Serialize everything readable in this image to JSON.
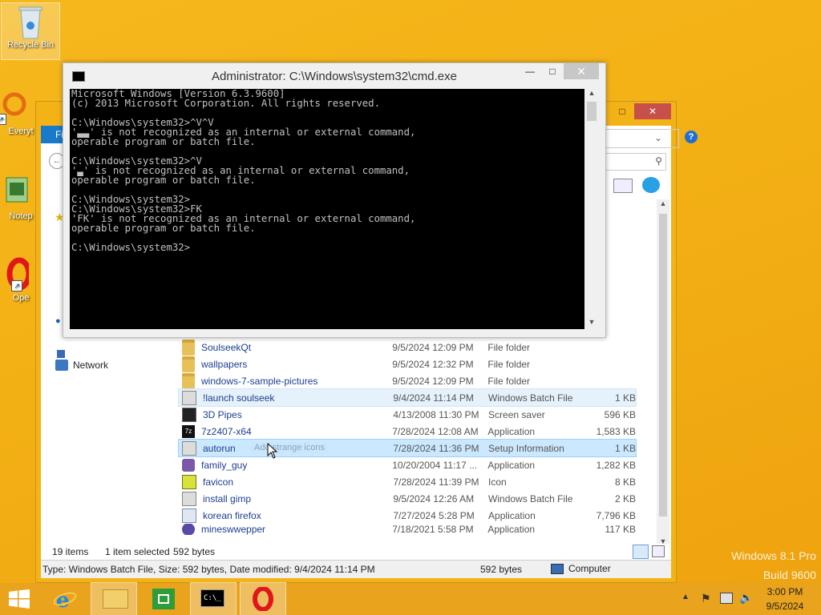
{
  "desktop": {
    "icons": [
      {
        "label": "Recycle Bin"
      },
      {
        "label": "Everyt"
      },
      {
        "label": "Notep"
      },
      {
        "label": "Ope"
      }
    ],
    "watermark_line1": "Windows 8.1 Pro",
    "watermark_line2": "Build 9600"
  },
  "cmd": {
    "title": "Administrator: C:\\Windows\\system32\\cmd.exe",
    "lines": [
      "Microsoft Windows [Version 6.3.9600]",
      "(c) 2013 Microsoft Corporation. All rights reserved.",
      "",
      "C:\\Windows\\system32>^V^V",
      "'▃▃' is not recognized as an internal or external command,",
      "operable program or batch file.",
      "",
      "C:\\Windows\\system32>^V",
      "'▃' is not recognized as an internal or external command,",
      "operable program or batch file.",
      "",
      "C:\\Windows\\system32>",
      "C:\\Windows\\system32>FK",
      "'FK' is not recognized as an internal or external command,",
      "operable program or batch file.",
      "",
      "C:\\Windows\\system32>"
    ]
  },
  "explorer": {
    "nav": {
      "network": "Network",
      "file_tab": "Fi"
    },
    "files": [
      {
        "name": "SoulseekQt",
        "date": "9/5/2024 12:09 PM",
        "type": "File folder",
        "size": "",
        "icon": "folder-icon"
      },
      {
        "name": "wallpapers",
        "date": "9/5/2024 12:32 PM",
        "type": "File folder",
        "size": "",
        "icon": "folder-icon"
      },
      {
        "name": "windows-7-sample-pictures",
        "date": "9/5/2024 12:09 PM",
        "type": "File folder",
        "size": "",
        "icon": "folder-icon"
      },
      {
        "name": "!launch soulseek",
        "date": "9/4/2024 11:14 PM",
        "type": "Windows Batch File",
        "size": "1 KB",
        "icon": "batch-file-icon"
      },
      {
        "name": "3D Pipes",
        "date": "4/13/2008 11:30 PM",
        "type": "Screen saver",
        "size": "596 KB",
        "icon": "screensaver-icon"
      },
      {
        "name": "7z2407-x64",
        "date": "7/28/2024 12:08 AM",
        "type": "Application",
        "size": "1,583 KB",
        "icon": "7zip-icon"
      },
      {
        "name": "autorun",
        "date": "7/28/2024 11:36 PM",
        "type": "Setup Information",
        "size": "1 KB",
        "icon": "setup-info-icon"
      },
      {
        "name": "family_guy",
        "date": "10/20/2004 11:17 ...",
        "type": "Application",
        "size": "1,282 KB",
        "icon": "application-icon"
      },
      {
        "name": "favicon",
        "date": "7/28/2024 11:39 PM",
        "type": "Icon",
        "size": "8 KB",
        "icon": "icon-file-icon"
      },
      {
        "name": "install gimp",
        "date": "9/5/2024 12:26 AM",
        "type": "Windows Batch File",
        "size": "2 KB",
        "icon": "batch-file-icon"
      },
      {
        "name": "korean firefox",
        "date": "7/27/2024 5:28 PM",
        "type": "Application",
        "size": "7,796 KB",
        "icon": "application-icon"
      },
      {
        "name": "mineswwepper",
        "date": "7/18/2021 5:58 PM",
        "type": "Application",
        "size": "117 KB",
        "icon": "minesweeper-icon"
      }
    ],
    "drag_ghost": "Add strange icons",
    "status": {
      "items": "19 items",
      "selected": "1 item selected",
      "size": "592 bytes"
    },
    "details_bar": {
      "info": "Type: Windows Batch File, Size: 592 bytes, Date modified: 9/4/2024 11:14 PM",
      "size": "592 bytes",
      "location": "Computer"
    }
  },
  "taskbar": {
    "time": "3:00 PM",
    "date": "9/5/2024"
  }
}
